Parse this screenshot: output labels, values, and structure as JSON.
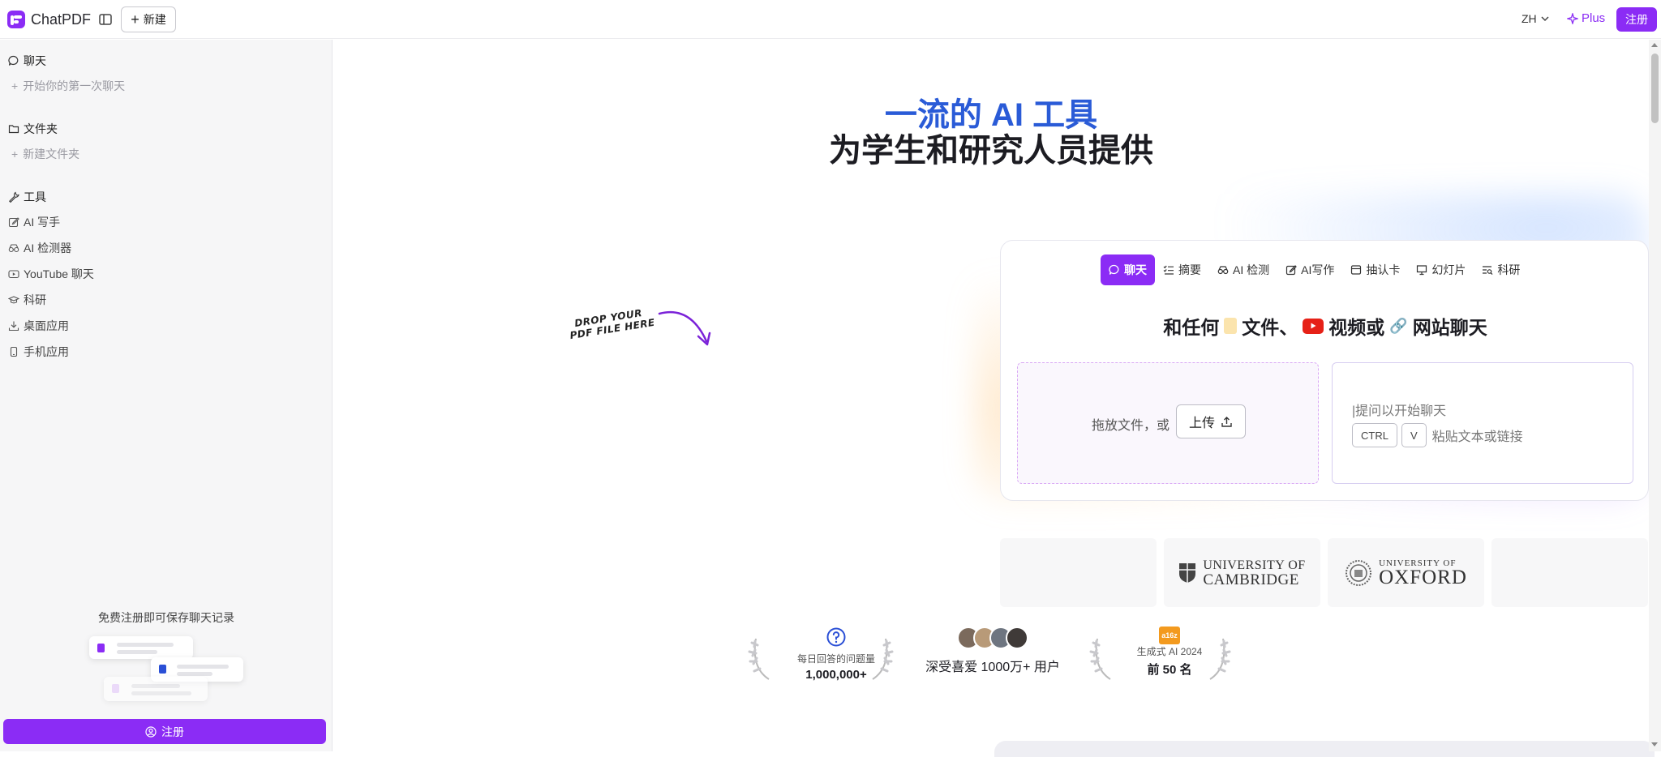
{
  "app": {
    "name": "ChatPDF"
  },
  "header": {
    "new_label": "新建",
    "lang": "ZH",
    "plus_label": "Plus",
    "signup_label": "注册"
  },
  "sidebar": {
    "chat_title": "聊天",
    "chat_sub": "开始你的第一次聊天",
    "folder_title": "文件夹",
    "folder_sub": "新建文件夹",
    "tools_title": "工具",
    "tools": [
      "AI 写手",
      "AI 检测器",
      "YouTube 聊天",
      "科研",
      "桌面应用",
      "手机应用"
    ],
    "save_prompt": "免费注册即可保存聊天记录",
    "signup_label": "注册"
  },
  "main": {
    "hero_line1": "一流的 AI 工具",
    "hero_line2": "为学生和研究人员提供",
    "tabs": [
      "聊天",
      "摘要",
      "AI 检测",
      "AI写作",
      "抽认卡",
      "幻灯片",
      "科研"
    ],
    "headline_part1": "和任何",
    "headline_part2": "文件、",
    "headline_part3": "视频或",
    "headline_part4": "网站聊天",
    "drop_label": "拖放文件，或",
    "upload_label": "上传",
    "chat_placeholder": "|提问以开始聊天",
    "key_ctrl": "CTRL",
    "key_v": "V",
    "paste_hint": "粘贴文本或链接",
    "hand_note_line1": "DROP YOUR",
    "hand_note_line2": "PDF FILE HERE",
    "uni1_line1": "UNIVERSITY OF",
    "uni1_line2": "CAMBRIDGE",
    "uni2_line1": "UNIVERSITY OF",
    "uni2_line2": "OXFORD",
    "stat1_label": "每日回答的问题量",
    "stat1_value": "1,000,000+",
    "stat2_text": "深受喜爱 1000万+ 用户",
    "stat3_badge": "a16z",
    "stat3_label": "生成式 AI 2024",
    "stat3_value": "前 50 名"
  },
  "colors": {
    "accent": "#8b2cf5",
    "hero_blue": "#2a5bd7"
  }
}
